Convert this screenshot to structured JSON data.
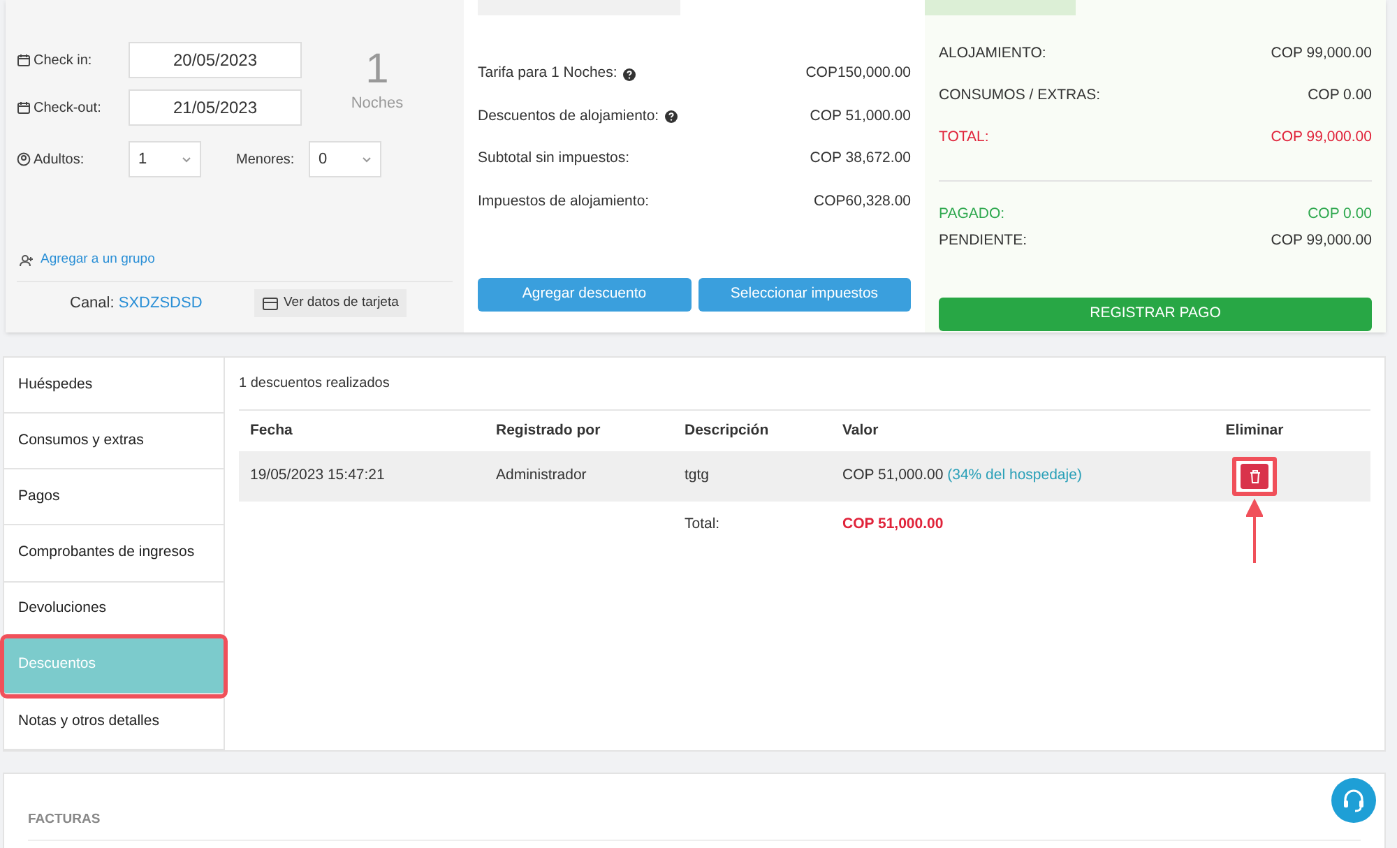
{
  "stay": {
    "checkin_label": "Check in:",
    "checkin": "20/05/2023",
    "checkout_label": "Check-out:",
    "checkout": "21/05/2023",
    "nights": "1",
    "nights_label": "Noches",
    "adults_label": "Adultos:",
    "adults": "1",
    "minors_label": "Menores:",
    "minors": "0",
    "group_link": "Agregar a un grupo",
    "channel_label": "Canal:",
    "channel": "SXDZSDSD",
    "card_button": "Ver datos de tarjeta"
  },
  "charges": {
    "rows": [
      {
        "label": "Tarifa para 1 Noches:",
        "help": true,
        "value": "COP150,000.00"
      },
      {
        "label": "Descuentos de alojamiento:",
        "help": true,
        "value": "COP 51,000.00"
      },
      {
        "label": "Subtotal sin impuestos:",
        "help": false,
        "value": "COP 38,672.00"
      },
      {
        "label": "Impuestos de alojamiento:",
        "help": false,
        "value": "COP60,328.00"
      }
    ],
    "buttons": [
      "Agregar descuento",
      "Seleccionar impuestos"
    ]
  },
  "totals": {
    "rows": [
      {
        "label": "ALOJAMIENTO:",
        "value": "COP 99,000.00",
        "kind": "plain"
      },
      {
        "label": "CONSUMOS / EXTRAS:",
        "value": "COP 0.00",
        "kind": "plain"
      },
      {
        "label": "TOTAL:",
        "value": "COP 99,000.00",
        "kind": "total"
      },
      {
        "label": "PAGADO:",
        "value": "COP 0.00",
        "kind": "paid"
      },
      {
        "label": "PENDIENTE:",
        "value": "COP 99,000.00",
        "kind": "plain"
      }
    ],
    "button": "REGISTRAR PAGO"
  },
  "sidebar": {
    "items": [
      {
        "label": "Huéspedes",
        "selected": false
      },
      {
        "label": "Consumos y extras",
        "selected": false
      },
      {
        "label": "Pagos",
        "selected": false
      },
      {
        "label": "Comprobantes de ingresos",
        "selected": false
      },
      {
        "label": "Devoluciones",
        "selected": false
      },
      {
        "label": "Descuentos",
        "selected": true
      },
      {
        "label": "Notas y otros detalles",
        "selected": false
      }
    ]
  },
  "discounts": {
    "summary": "1 descuentos realizados",
    "columns": [
      "Fecha",
      "Registrado por",
      "Descripción",
      "Valor",
      "Eliminar"
    ],
    "rows": [
      {
        "date": "19/05/2023 15:47:21",
        "by": "Administrador",
        "description": "tgtg",
        "value": "COP 51,000.00",
        "note": "(34% del hospedaje)"
      }
    ],
    "total_label": "Total:",
    "total": "COP 51,000.00"
  },
  "invoices": {
    "title": "FACTURAS"
  }
}
